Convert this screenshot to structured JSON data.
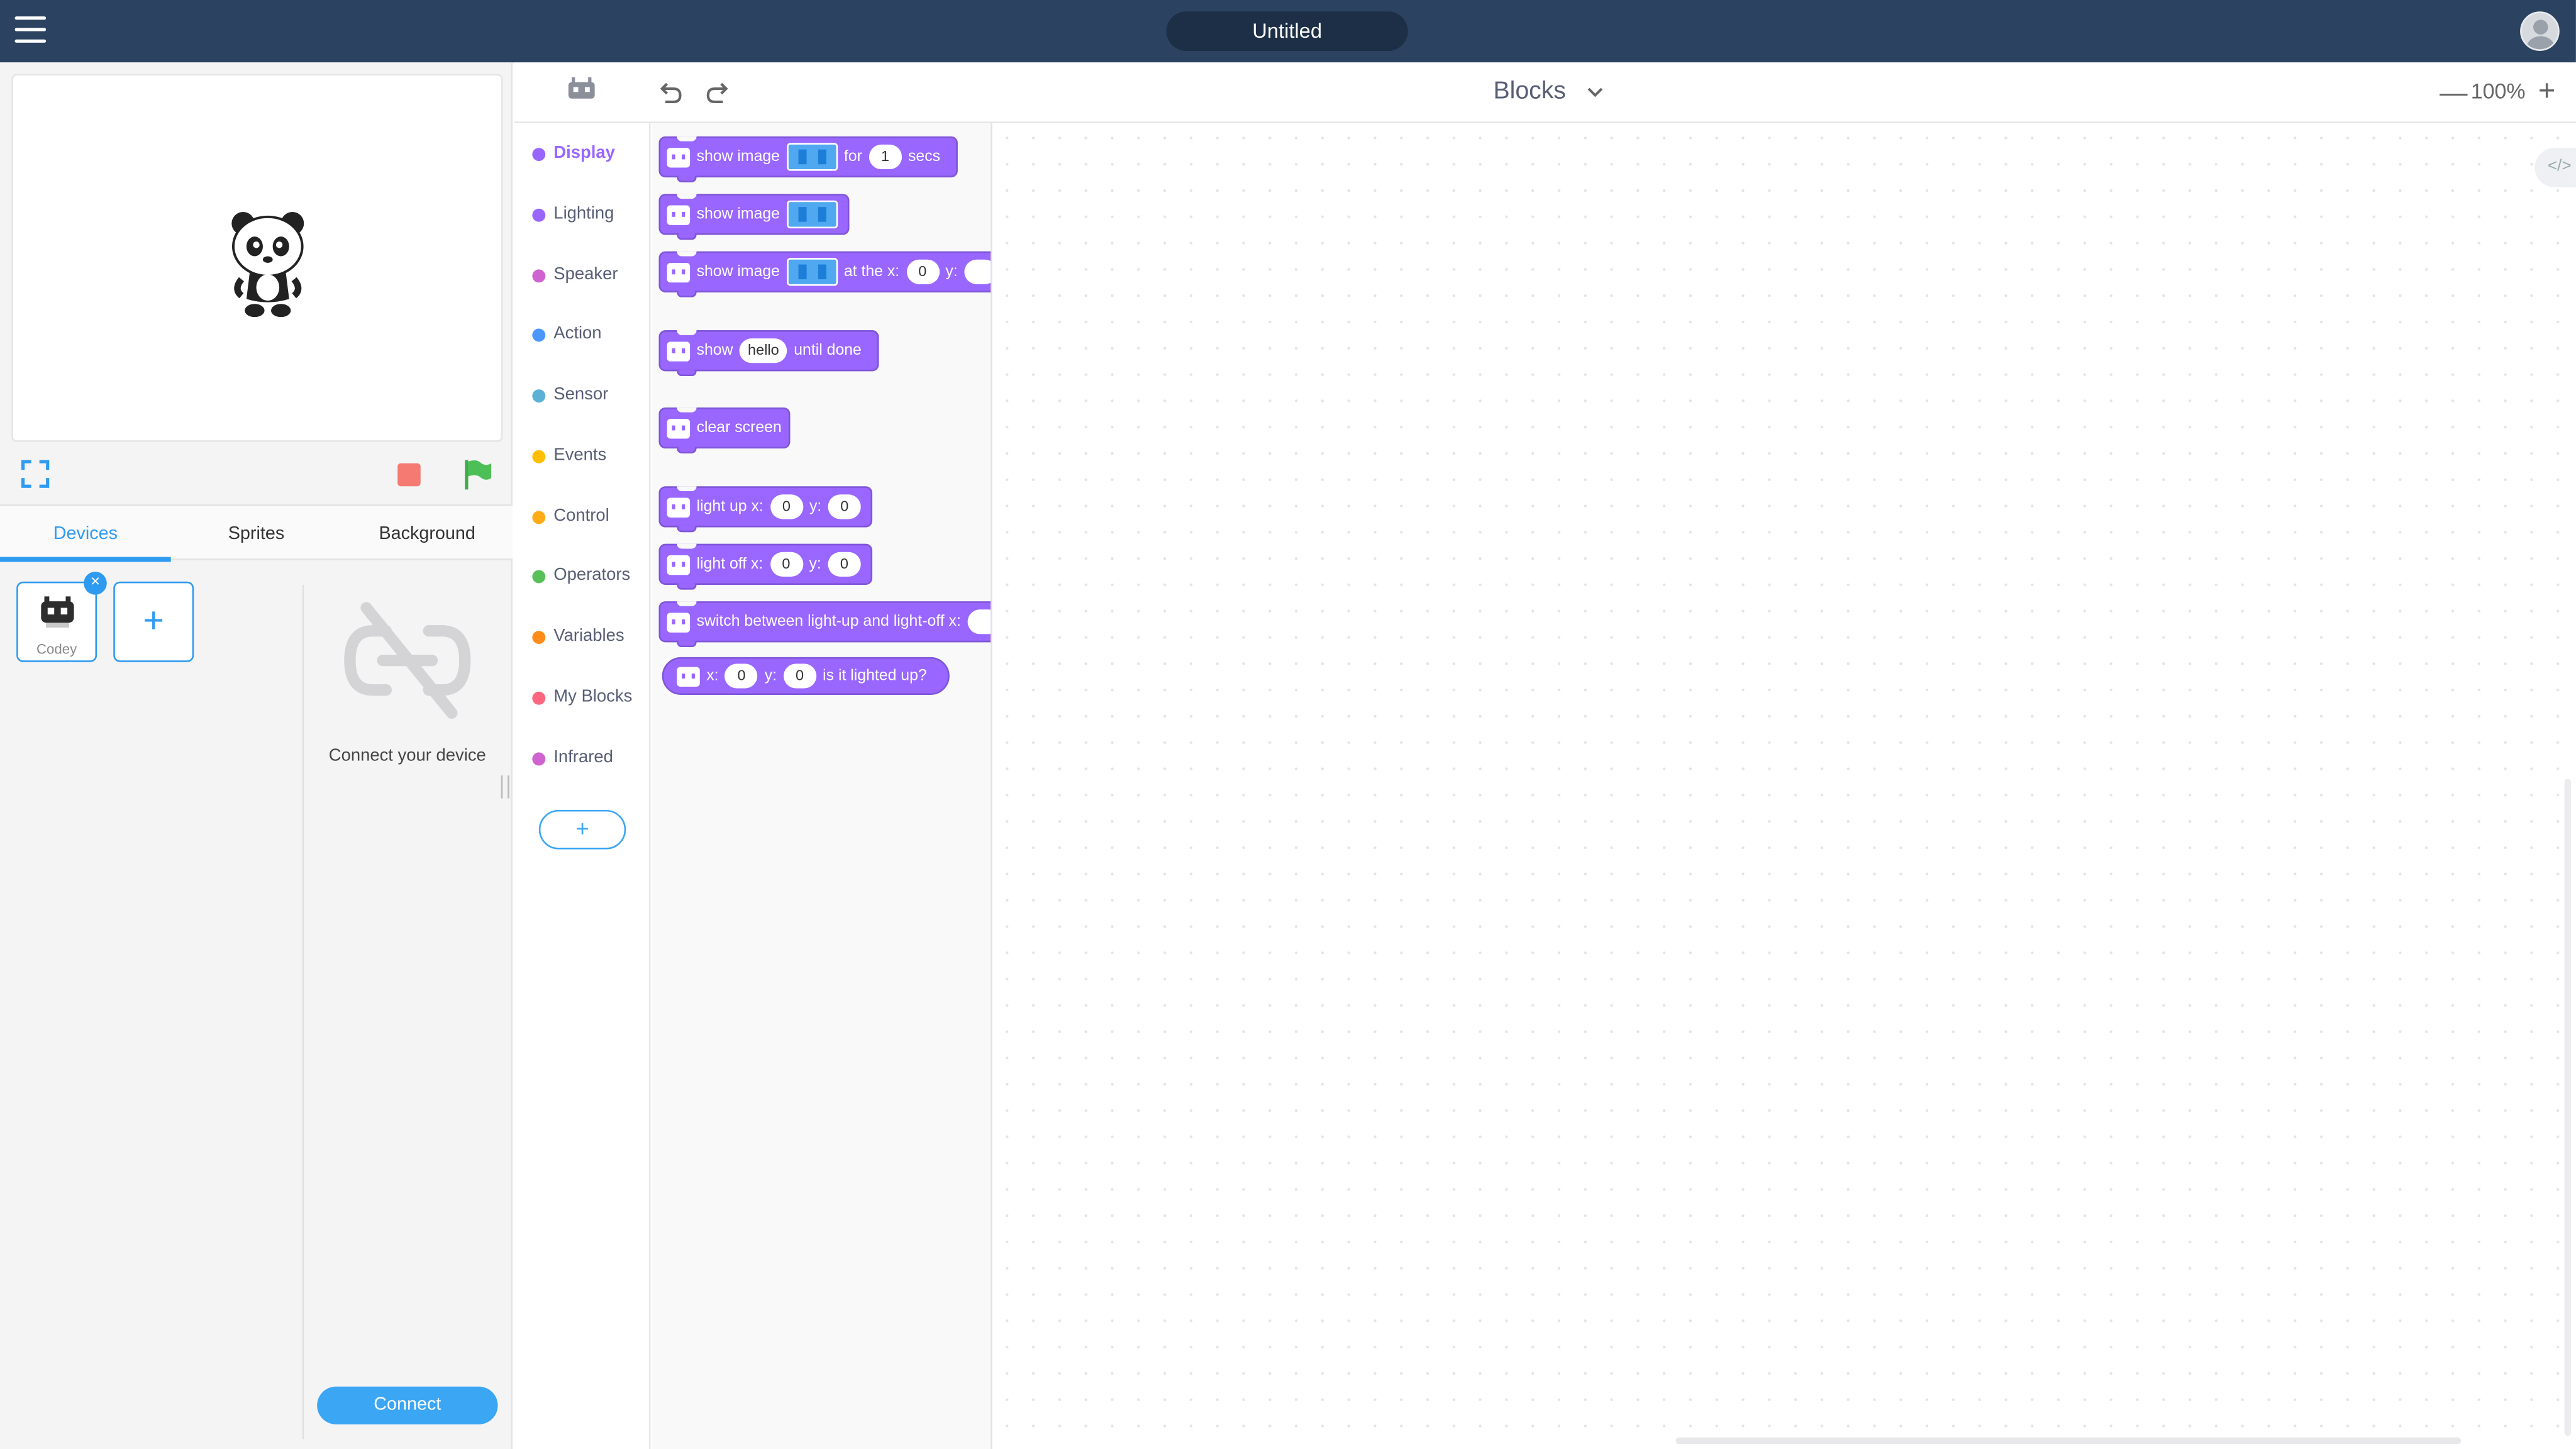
{
  "header": {
    "title": "Untitled"
  },
  "toolbar": {
    "mode": "Blocks",
    "zoom": "100%",
    "zoom_minus": "—",
    "zoom_plus": "+"
  },
  "left_tabs": [
    {
      "label": "Devices",
      "active": true
    },
    {
      "label": "Sprites",
      "active": false
    },
    {
      "label": "Background",
      "active": false
    }
  ],
  "devices": [
    {
      "name": "Codey"
    }
  ],
  "add_device_label": "+",
  "connect_panel": {
    "message": "Connect your device",
    "button": "Connect"
  },
  "categories": [
    {
      "label": "Display",
      "color": "#9966ff",
      "active": true
    },
    {
      "label": "Lighting",
      "color": "#9966ff"
    },
    {
      "label": "Speaker",
      "color": "#cf63cf"
    },
    {
      "label": "Action",
      "color": "#4c97ff"
    },
    {
      "label": "Sensor",
      "color": "#5cb1d6"
    },
    {
      "label": "Events",
      "color": "#ffbf00"
    },
    {
      "label": "Control",
      "color": "#ffab19"
    },
    {
      "label": "Operators",
      "color": "#59c059"
    },
    {
      "label": "Variables",
      "color": "#ff8c1a"
    },
    {
      "label": "My Blocks",
      "color": "#ff6680"
    },
    {
      "label": "Infrared",
      "color": "#cf63cf"
    }
  ],
  "blocks": {
    "b1": {
      "text1": "show image",
      "text2": "for",
      "val": "1",
      "text3": "secs"
    },
    "b2": {
      "text1": "show image"
    },
    "b3": {
      "text1": "show image",
      "text2": "at the x:",
      "x": "0",
      "text3": "y:"
    },
    "b4": {
      "text1": "show",
      "val": "hello",
      "text2": "until done"
    },
    "b5": {
      "text1": "clear screen"
    },
    "b6": {
      "text1": "light up x:",
      "x": "0",
      "text2": "y:",
      "y": "0"
    },
    "b7": {
      "text1": "light off x:",
      "x": "0",
      "text2": "y:",
      "y": "0"
    },
    "b8": {
      "text1": "switch between light-up and light-off x:"
    },
    "b9": {
      "text1": "x:",
      "x": "0",
      "text2": "y:",
      "y": "0",
      "text3": "is it lighted up?"
    }
  },
  "extension_button": "+",
  "code_toggle": "</>",
  "colors": {
    "header": "#2b4261",
    "accent": "#2e9bf0",
    "looks": "#9966ff",
    "stop": "#f47a72",
    "go": "#4cbf56"
  }
}
